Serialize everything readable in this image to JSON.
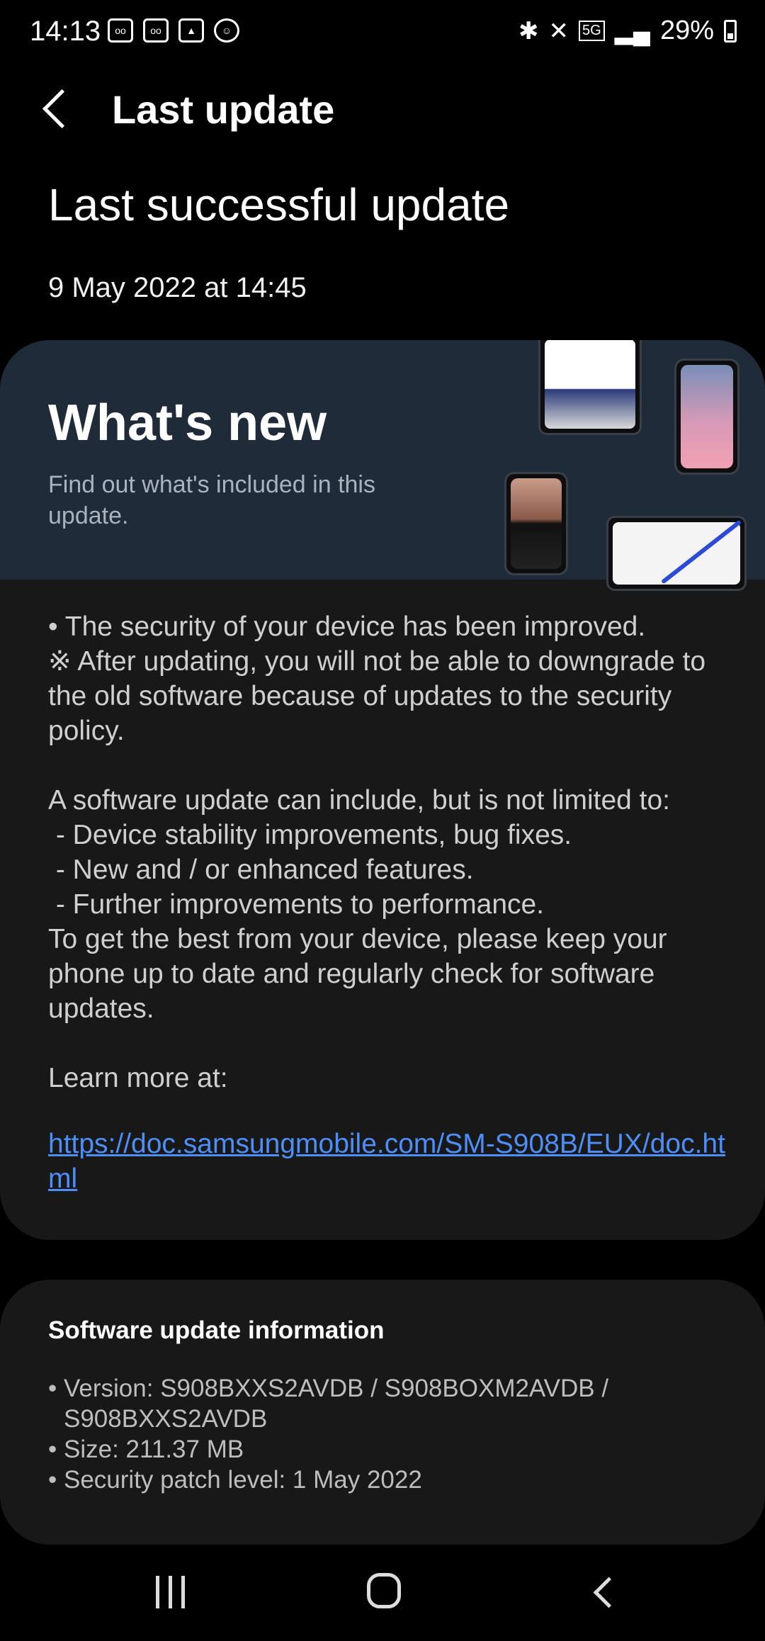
{
  "status_bar": {
    "time": "14:13",
    "battery": "29%",
    "network": "5G",
    "left_icons": [
      "voicemail-icon",
      "voicemail-icon",
      "gallery-icon",
      "snapchat-icon"
    ],
    "right_icons": [
      "bluetooth-icon",
      "mute-icon",
      "5g-icon",
      "signal-icon",
      "battery-icon"
    ]
  },
  "header": {
    "title": "Last update"
  },
  "last_update": {
    "heading": "Last successful update",
    "date": "9 May 2022 at 14:45"
  },
  "whats_new": {
    "title": "What's new",
    "subtitle": "Find out what's included in this update.",
    "body": "• The security of your device has been improved.\n※ After updating, you will not be able to downgrade to the old software because of updates to the security policy.\n\nA software update can include, but is not limited to:\n - Device stability improvements, bug fixes.\n - New and / or enhanced features.\n - Further improvements to performance.\nTo get the best from your device, please keep your phone up to date and regularly check for software updates.\n\nLearn more at:",
    "link": "https://doc.samsungmobile.com/SM-S908B/EUX/doc.html"
  },
  "software_info": {
    "title": "Software update information",
    "items": [
      "Version: S908BXXS2AVDB / S908BOXM2AVDB / S908BXXS2AVDB",
      "Size: 211.37 MB",
      "Security patch level: 1 May 2022"
    ]
  },
  "colors": {
    "background": "#000000",
    "card": "#181818",
    "banner": "#1f2b39",
    "link": "#4e8ef7"
  }
}
